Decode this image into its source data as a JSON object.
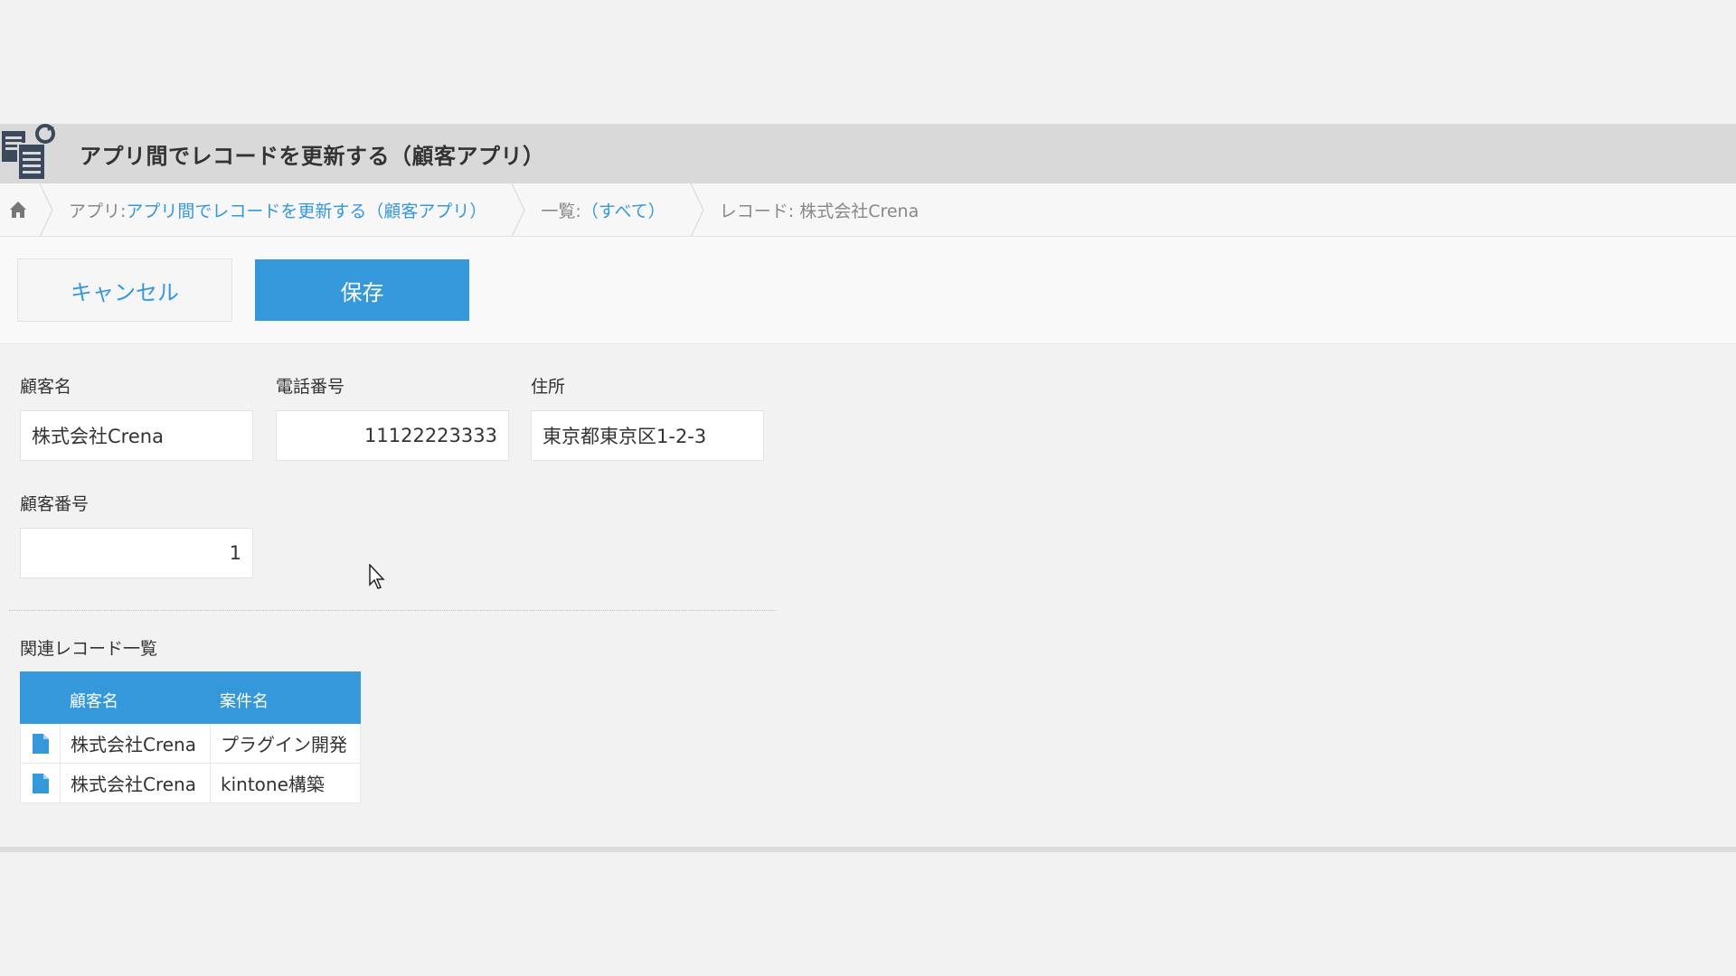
{
  "app": {
    "title": "アプリ間でレコードを更新する（顧客アプリ）",
    "icon": "app-records-sync-icon"
  },
  "breadcrumb": {
    "home_icon": "home-icon",
    "app_prefix": "アプリ: ",
    "app_name": "アプリ間でレコードを更新する（顧客アプリ）",
    "list_prefix": "一覧: ",
    "list_name": "（すべて）",
    "record_label": "レコード: 株式会社Crena"
  },
  "toolbar": {
    "cancel_label": "キャンセル",
    "save_label": "保存"
  },
  "form": {
    "customer_name": {
      "label": "顧客名",
      "value": "株式会社Crena"
    },
    "phone": {
      "label": "電話番号",
      "value": "11122223333"
    },
    "address": {
      "label": "住所",
      "value": "東京都東京区1-2-3"
    },
    "customer_number": {
      "label": "顧客番号",
      "value": "1"
    }
  },
  "related": {
    "title": "関連レコード一覧",
    "columns": [
      "顧客名",
      "案件名"
    ],
    "rows": [
      {
        "customer": "株式会社Crena",
        "project": "プラグイン開発"
      },
      {
        "customer": "株式会社Crena",
        "project": "kintone構築"
      }
    ]
  },
  "colors": {
    "accent": "#3498db",
    "header_bg": "#d9d9d9",
    "page_bg": "#f2f2f2"
  }
}
